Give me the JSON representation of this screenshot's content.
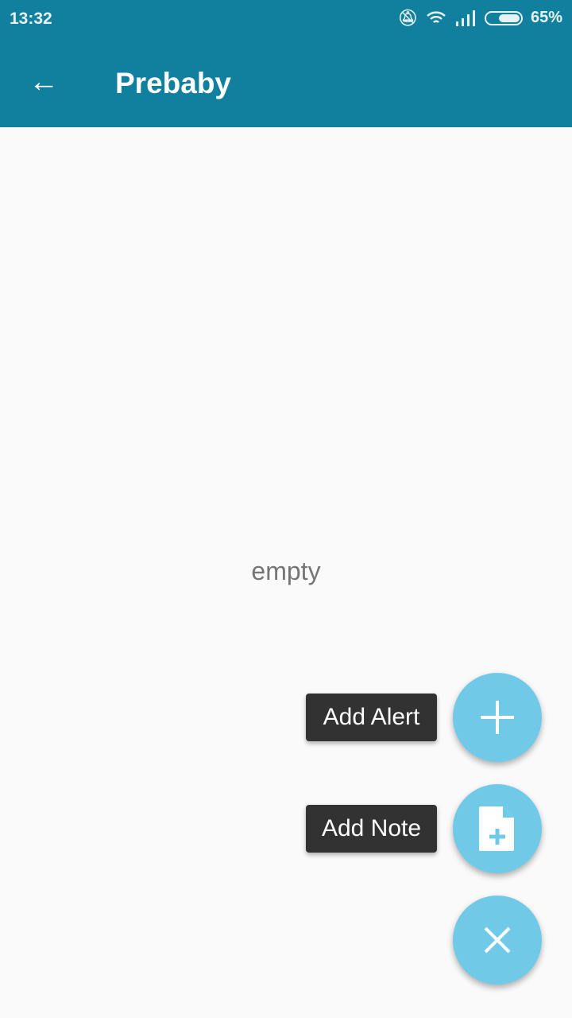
{
  "status": {
    "time": "13:32",
    "battery": "65%",
    "battery_level": 0.65
  },
  "appbar": {
    "title": "Prebaby"
  },
  "main": {
    "empty_text": "empty"
  },
  "fab_menu": {
    "add_alert": "Add Alert",
    "add_note": "Add Note"
  },
  "colors": {
    "primary": "#10809e",
    "fab": "#71c9e8"
  }
}
